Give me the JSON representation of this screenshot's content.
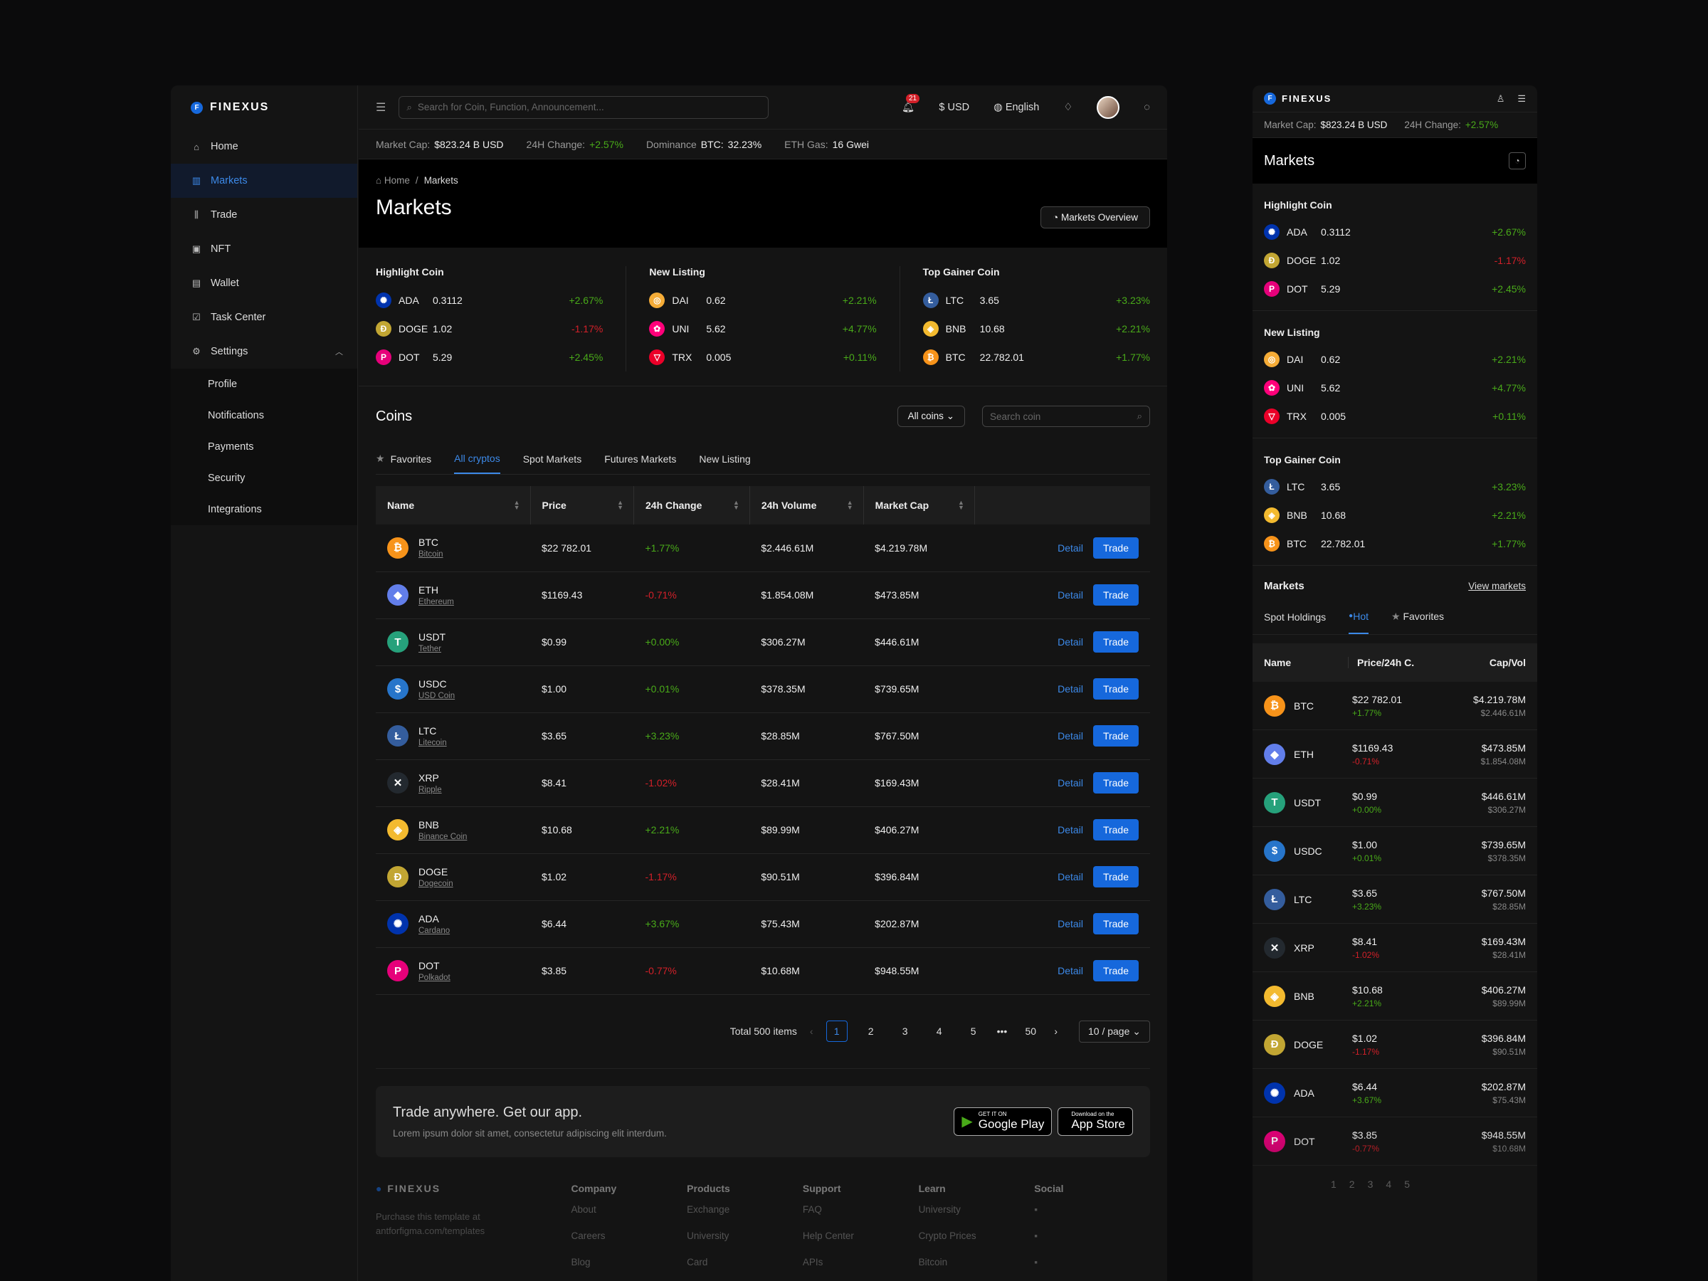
{
  "brand": {
    "name": "FINEXUS"
  },
  "sidebar": {
    "items": [
      {
        "label": "Home",
        "icon": "home-icon"
      },
      {
        "label": "Markets",
        "icon": "chart-icon",
        "active": true
      },
      {
        "label": "Trade",
        "icon": "candles-icon"
      },
      {
        "label": "NFT",
        "icon": "image-icon"
      },
      {
        "label": "Wallet",
        "icon": "wallet-icon"
      },
      {
        "label": "Task Center",
        "icon": "checkbox-icon"
      },
      {
        "label": "Settings",
        "icon": "gear-icon"
      }
    ],
    "settings_sub": [
      "Profile",
      "Notifications",
      "Payments",
      "Security",
      "Integrations"
    ]
  },
  "topbar": {
    "search_placeholder": "Search for Coin, Function, Announcement...",
    "notifications": "21",
    "currency": "USD",
    "language": "English"
  },
  "ticker": {
    "market_cap_label": "Market Cap:",
    "market_cap": "$823.24 B USD",
    "change_label": "24H Change:",
    "change": "+2.57%",
    "dominance_label": "Dominance",
    "dominance_coin": "BTC:",
    "dominance": "32.23%",
    "gas_label": "ETH Gas:",
    "gas": "16 Gwei"
  },
  "page": {
    "breadcrumb_home": "Home",
    "breadcrumb_sep": "/",
    "breadcrumb_current": "Markets",
    "title": "Markets",
    "overview_button": "Markets Overview"
  },
  "highlights": [
    {
      "title": "Highlight Coin",
      "rows": [
        {
          "sym": "ADA",
          "price": "0.3112",
          "change": "+2.67%",
          "up": true
        },
        {
          "sym": "DOGE",
          "price": "1.02",
          "change": "-1.17%",
          "up": false
        },
        {
          "sym": "DOT",
          "price": "5.29",
          "change": "+2.45%",
          "up": true
        }
      ]
    },
    {
      "title": "New Listing",
      "rows": [
        {
          "sym": "DAI",
          "price": "0.62",
          "change": "+2.21%",
          "up": true
        },
        {
          "sym": "UNI",
          "price": "5.62",
          "change": "+4.77%",
          "up": true
        },
        {
          "sym": "TRX",
          "price": "0.005",
          "change": "+0.11%",
          "up": true
        }
      ]
    },
    {
      "title": "Top Gainer Coin",
      "rows": [
        {
          "sym": "LTC",
          "price": "3.65",
          "change": "+3.23%",
          "up": true
        },
        {
          "sym": "BNB",
          "price": "10.68",
          "change": "+2.21%",
          "up": true
        },
        {
          "sym": "BTC",
          "price": "22.782.01",
          "change": "+1.77%",
          "up": true
        }
      ]
    }
  ],
  "coins": {
    "title": "Coins",
    "filter": "All coins",
    "search_placeholder": "Search coin",
    "tabs": [
      "Favorites",
      "All cryptos",
      "Spot Markets",
      "Futures Markets",
      "New Listing"
    ],
    "columns": [
      "Name",
      "Price",
      "24h Change",
      "24h Volume",
      "Market Cap"
    ],
    "detail_label": "Detail",
    "trade_label": "Trade",
    "rows": [
      {
        "sym": "BTC",
        "name": "Bitcoin",
        "price": "$22 782.01",
        "change": "+1.77%",
        "up": true,
        "volume": "$2.446.61M",
        "cap": "$4.219.78M"
      },
      {
        "sym": "ETH",
        "name": "Ethereum",
        "price": "$1169.43",
        "change": "-0.71%",
        "up": false,
        "volume": "$1.854.08M",
        "cap": "$473.85M"
      },
      {
        "sym": "USDT",
        "name": "Tether",
        "price": "$0.99",
        "change": "+0.00%",
        "up": true,
        "volume": "$306.27M",
        "cap": "$446.61M"
      },
      {
        "sym": "USDC",
        "name": "USD Coin",
        "price": "$1.00",
        "change": "+0.01%",
        "up": true,
        "volume": "$378.35M",
        "cap": "$739.65M"
      },
      {
        "sym": "LTC",
        "name": "Litecoin",
        "price": "$3.65",
        "change": "+3.23%",
        "up": true,
        "volume": "$28.85M",
        "cap": "$767.50M"
      },
      {
        "sym": "XRP",
        "name": "Ripple",
        "price": "$8.41",
        "change": "-1.02%",
        "up": false,
        "volume": "$28.41M",
        "cap": "$169.43M"
      },
      {
        "sym": "BNB",
        "name": "Binance Coin",
        "price": "$10.68",
        "change": "+2.21%",
        "up": true,
        "volume": "$89.99M",
        "cap": "$406.27M"
      },
      {
        "sym": "DOGE",
        "name": "Dogecoin",
        "price": "$1.02",
        "change": "-1.17%",
        "up": false,
        "volume": "$90.51M",
        "cap": "$396.84M"
      },
      {
        "sym": "ADA",
        "name": "Cardano",
        "price": "$6.44",
        "change": "+3.67%",
        "up": true,
        "volume": "$75.43M",
        "cap": "$202.87M"
      },
      {
        "sym": "DOT",
        "name": "Polkadot",
        "price": "$3.85",
        "change": "-0.77%",
        "up": false,
        "volume": "$10.68M",
        "cap": "$948.55M"
      }
    ]
  },
  "pagination": {
    "total": "Total 500 items",
    "pages": [
      "1",
      "2",
      "3",
      "4",
      "5",
      "50"
    ],
    "ellipsis": "•••",
    "size": "10 / page"
  },
  "app_promo": {
    "title": "Trade anywhere. Get our app.",
    "text": "Lorem ipsum dolor sit amet, consectetur adipiscing elit interdum.",
    "google_small": "GET IT ON",
    "google": "Google Play",
    "apple_small": "Download on the",
    "apple": "App Store"
  },
  "footer": {
    "text": "Purchase this template at antforfigma.com/templates",
    "cols": [
      {
        "title": "Company",
        "links": [
          "About",
          "Careers",
          "Blog"
        ]
      },
      {
        "title": "Products",
        "links": [
          "Exchange",
          "University",
          "Card"
        ]
      },
      {
        "title": "Support",
        "links": [
          "FAQ",
          "Help Center",
          "APIs"
        ]
      },
      {
        "title": "Learn",
        "links": [
          "University",
          "Crypto Prices",
          "Bitcoin"
        ]
      },
      {
        "title": "Social",
        "links": []
      }
    ]
  },
  "mobile": {
    "ticker_change_label": "24H Change:",
    "title": "Markets",
    "markets_title": "Markets",
    "view_markets": "View markets",
    "tabs": [
      "Spot Holdings",
      "Hot",
      "Favorites"
    ],
    "columns": [
      "Name",
      "Price/24h C.",
      "Cap/Vol"
    ],
    "pages": [
      "1",
      "2",
      "3",
      "4",
      "5"
    ]
  },
  "colors": {
    "accent": "#1668dc",
    "up": "#49aa19",
    "down": "#d32029"
  }
}
